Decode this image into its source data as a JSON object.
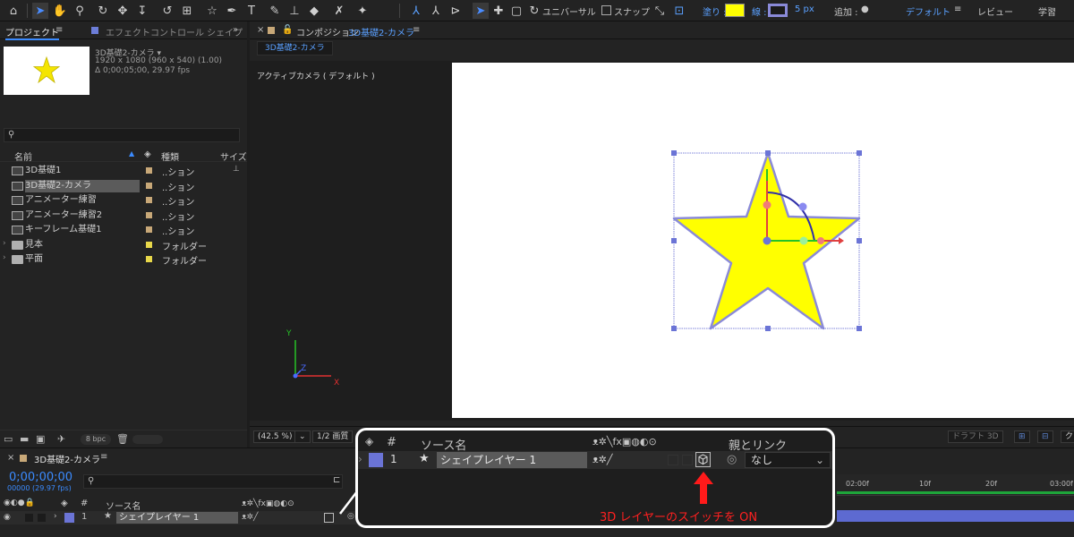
{
  "toolbar": {
    "universal_label": "ユニバーサル",
    "snap_label": "スナップ",
    "fill_label": "塗り :",
    "stroke_label": "線 :",
    "stroke_width": "5 px",
    "add_label": "追加 :",
    "workspace_default": "デフォルト",
    "workspace_review": "レビュー",
    "workspace_learn": "学習",
    "fill_color": "#ffff00",
    "stroke_color": "#8a8ad8"
  },
  "project": {
    "tab_label": "プロジェクト",
    "tab2_label": "エフェクトコントロール シェイプ",
    "comp_name": "3D基礎2-カメラ ▾",
    "comp_size": "1920 x 1080  (960 x 540) (1.00)",
    "comp_duration": "Δ 0;00;05;00, 29.97 fps",
    "col_name": "名前",
    "col_type": "種類",
    "col_size": "サイズ",
    "bpc": "8 bpc",
    "items": [
      {
        "name": "3D基礎1",
        "type": "..ション",
        "label_color": "#c8a878",
        "kind": "comp"
      },
      {
        "name": "3D基礎2-カメラ",
        "type": "..ション",
        "label_color": "#c8a878",
        "kind": "comp"
      },
      {
        "name": "アニメーター練習",
        "type": "..ション",
        "label_color": "#c8a878",
        "kind": "comp"
      },
      {
        "name": "アニメーター練習2",
        "type": "..ション",
        "label_color": "#c8a878",
        "kind": "comp"
      },
      {
        "name": "キーフレーム基礎1",
        "type": "..ション",
        "label_color": "#c8a878",
        "kind": "comp"
      },
      {
        "name": "見本",
        "type": "フォルダー",
        "label_color": "#e8d84a",
        "kind": "folder"
      },
      {
        "name": "平面",
        "type": "フォルダー",
        "label_color": "#e8d84a",
        "kind": "folder"
      }
    ]
  },
  "composition": {
    "tab_prefix": "コンポジション",
    "tab_name": "3D基礎2-カメラ",
    "subtab": "3D基礎2-カメラ",
    "camera_label": "アクティブカメラ ( デフォルト )",
    "zoom": "(42.5 %)",
    "resolution": "1/2 画質",
    "draft3d": "ドラフト 3D",
    "axis_x": "X",
    "axis_y": "Y",
    "axis_z": "Z"
  },
  "timeline": {
    "tab_name": "3D基礎2-カメラ",
    "timecode": "0;00;00;00",
    "timecode_sub": "00000 (29.97 fps)",
    "col_hash": "#",
    "col_source": "ソース名",
    "layer_index": "1",
    "layer_name": "シェイプレイヤー 1",
    "ruler_ticks": [
      "02:00f",
      "10f",
      "20f",
      "03:00f"
    ]
  },
  "callout": {
    "col_hash": "#",
    "col_source": "ソース名",
    "col_parent": "親とリンク",
    "layer_index": "1",
    "layer_name": "シェイプレイヤー 1",
    "parent_value": "なし",
    "caption": "3D レイヤーのスイッチを ON"
  }
}
